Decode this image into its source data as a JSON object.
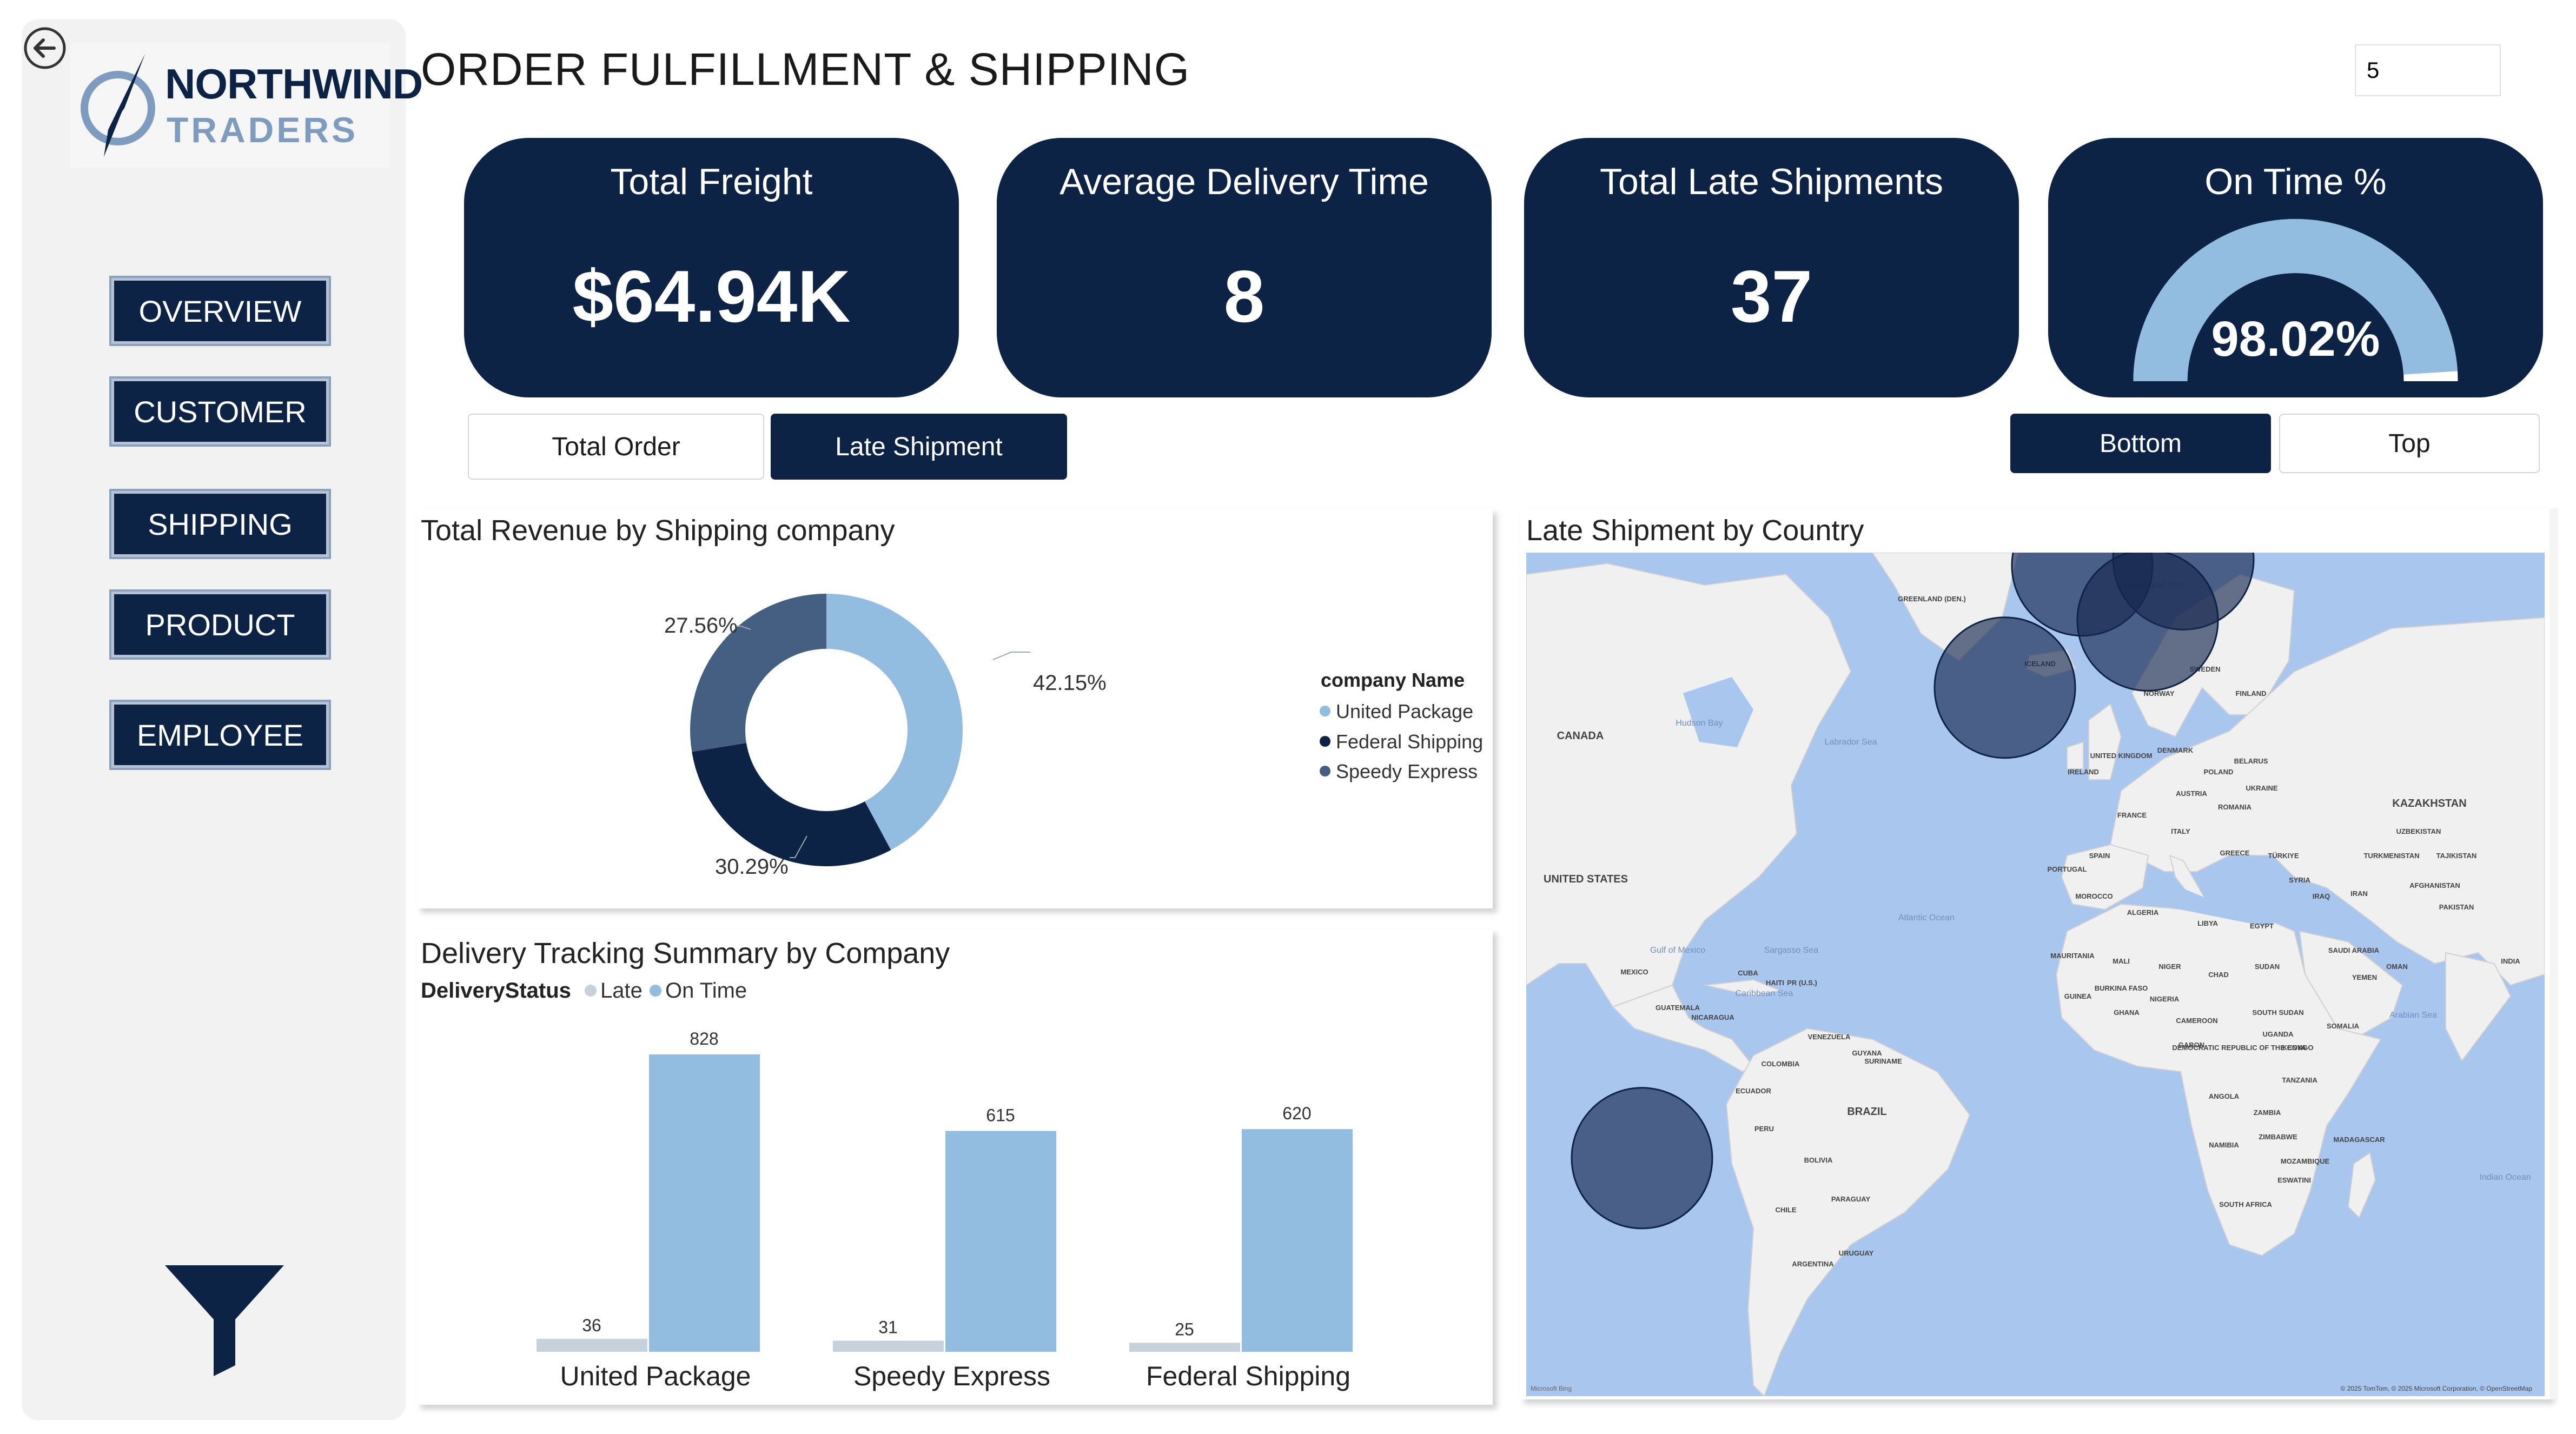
{
  "logo": {
    "line1": "NORTHWIND",
    "line2": "TRADERS"
  },
  "nav": [
    "OVERVIEW",
    "CUSTOMER",
    "SHIPPING",
    "PRODUCT",
    "EMPLOYEE"
  ],
  "page_title": "ORDER FULFILLMENT & SHIPPING",
  "topn_value": "5",
  "kpis": {
    "freight": {
      "title": "Total Freight",
      "value": "$64.94K"
    },
    "delivery": {
      "title": "Average Delivery Time",
      "value": "8"
    },
    "late": {
      "title": "Total Late Shipments",
      "value": "37"
    },
    "ontime": {
      "title": "On Time %",
      "value": "98.02%",
      "gauge_fraction": 0.9802
    }
  },
  "toggles": {
    "total_order": "Total Order",
    "late_shipment": "Late Shipment",
    "bottom": "Bottom",
    "top": "Top"
  },
  "colors": {
    "navy": "#0d2346",
    "united": "#93bce1",
    "federal": "#0d2346",
    "speedy": "#445f82",
    "late": "#c7d1dc",
    "ontime": "#93bce1"
  },
  "donut": {
    "title": "Total Revenue by Shipping company",
    "legend_title": "company Name",
    "legend": [
      "United Package",
      "Federal Shipping",
      "Speedy Express"
    ],
    "labels": [
      "42.15%",
      "30.29%",
      "27.56%"
    ]
  },
  "bar": {
    "title": "Delivery Tracking Summary by Company",
    "legend_title": "DeliveryStatus",
    "legend": [
      "Late",
      "On Time"
    ],
    "value_labels": [
      "36",
      "828",
      "31",
      "615",
      "25",
      "620"
    ]
  },
  "map": {
    "title": "Late Shipment by Country",
    "ocean_labels": [
      "Atlantic Ocean",
      "Indian Ocean",
      "Norwegian Sea",
      "Hudson Bay",
      "Labrador Sea",
      "Sargasso Sea",
      "Gulf of Mexico",
      "Caribbean Sea",
      "Arabian Sea"
    ],
    "country_labels": [
      "GREENLAND (DEN.)",
      "ICELAND",
      "CANADA",
      "UNITED STATES",
      "MEXICO",
      "CUBA",
      "HAITI",
      "PR (U.S.)",
      "GUATEMALA",
      "NICARAGUA",
      "VENEZUELA",
      "GUYANA",
      "SURINAME",
      "COLOMBIA",
      "ECUADOR",
      "PERU",
      "BRAZIL",
      "BOLIVIA",
      "PARAGUAY",
      "CHILE",
      "ARGENTINA",
      "URUGUAY",
      "NORWAY",
      "SWEDEN",
      "FINLAND",
      "DENMARK",
      "UNITED KINGDOM",
      "IRELAND",
      "POLAND",
      "BELARUS",
      "UKRAINE",
      "AUSTRIA",
      "ROMANIA",
      "FRANCE",
      "ITALY",
      "SPAIN",
      "PORTUGAL",
      "MOROCCO",
      "ALGERIA",
      "LIBYA",
      "EGYPT",
      "MAURITANIA",
      "MALI",
      "NIGER",
      "CHAD",
      "SUDAN",
      "GUINEA",
      "BURKINA FASO",
      "GHANA",
      "NIGERIA",
      "CAMEROON",
      "GABON",
      "SOUTH SUDAN",
      "UGANDA",
      "KENYA",
      "SOMALIA",
      "DEMOCRATIC REPUBLIC OF THE CONGO",
      "TANZANIA",
      "ANGOLA",
      "ZAMBIA",
      "NAMIBIA",
      "ZIMBABWE",
      "MOZAMBIQUE",
      "MADAGASCAR",
      "ESWATINI",
      "SOUTH AFRICA",
      "GREECE",
      "TÜRKIYE",
      "SYRIA",
      "IRAQ",
      "IRAN",
      "SAUDI ARABIA",
      "YEMEN",
      "OMAN",
      "KAZAKHSTAN",
      "UZBEKISTAN",
      "TURKMENISTAN",
      "TAJIKISTAN",
      "AFGHANISTAN",
      "PAKISTAN",
      "INDIA"
    ],
    "footer_left": "Microsoft Bing",
    "copyright": "© 2025 TomTom, © 2025 Microsoft Corporation, © OpenStreetMap"
  },
  "chart_data": [
    {
      "type": "pie",
      "title": "Total Revenue by Shipping company",
      "legend_title": "company Name",
      "categories": [
        "United Package",
        "Federal Shipping",
        "Speedy Express"
      ],
      "values": [
        42.15,
        30.29,
        27.56
      ]
    },
    {
      "type": "bar",
      "title": "Delivery Tracking Summary by Company",
      "categories": [
        "United Package",
        "Speedy Express",
        "Federal Shipping"
      ],
      "series": [
        {
          "name": "Late",
          "values": [
            36,
            31,
            25
          ]
        },
        {
          "name": "On Time",
          "values": [
            828,
            615,
            620
          ]
        }
      ]
    },
    {
      "type": "scatter",
      "title": "Late Shipment by Country",
      "note": "bubble map",
      "points": [
        {
          "region": "Norway",
          "lat": 61,
          "lon": 9
        },
        {
          "region": "Finland",
          "lat": 62,
          "lon": 26
        },
        {
          "region": "Poland",
          "lat": 52,
          "lon": 20
        },
        {
          "region": "Spain",
          "lat": 41,
          "lon": -4
        },
        {
          "region": "Argentina",
          "lat": -36,
          "lon": -65
        }
      ]
    }
  ]
}
